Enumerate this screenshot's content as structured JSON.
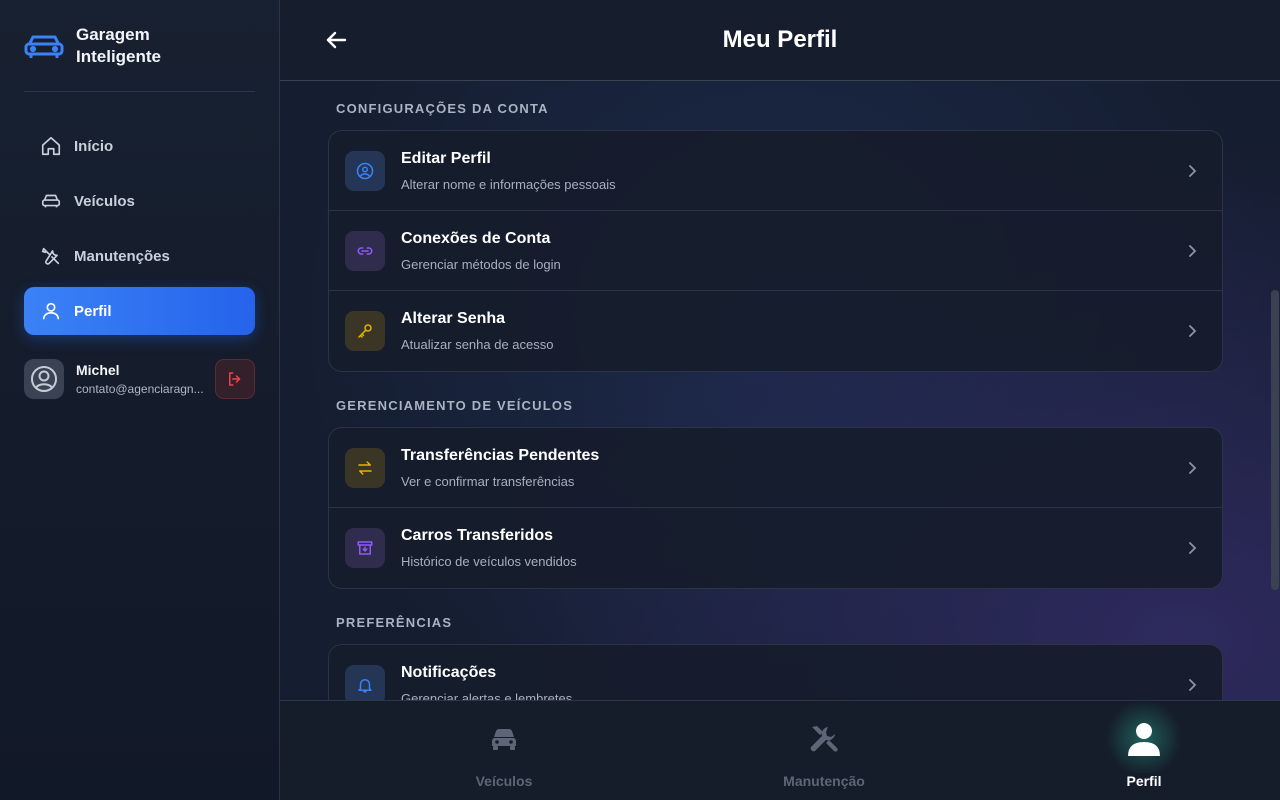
{
  "brand": {
    "name": "Garagem Inteligente",
    "icon": "car-icon",
    "color": "#3b82f6"
  },
  "sidebar": {
    "items": [
      {
        "label": "Início",
        "icon": "home-icon",
        "active": false
      },
      {
        "label": "Veículos",
        "icon": "car-icon",
        "active": false
      },
      {
        "label": "Manutenções",
        "icon": "tools-icon",
        "active": false
      },
      {
        "label": "Perfil",
        "icon": "user-icon",
        "active": true
      }
    ],
    "user": {
      "name": "Michel",
      "email": "contato@agenciaragn..."
    }
  },
  "header": {
    "title": "Meu Perfil",
    "back_icon": "arrow-left-icon"
  },
  "sections": [
    {
      "title": "CONFIGURAÇÕES DA CONTA",
      "items": [
        {
          "title": "Editar Perfil",
          "subtitle": "Alterar nome e informações pessoais",
          "icon": "user-circle-icon",
          "color": "#3b82f6"
        },
        {
          "title": "Conexões de Conta",
          "subtitle": "Gerenciar métodos de login",
          "icon": "link-icon",
          "color": "#8b5cf6"
        },
        {
          "title": "Alterar Senha",
          "subtitle": "Atualizar senha de acesso",
          "icon": "key-icon",
          "color": "#eab308"
        }
      ]
    },
    {
      "title": "GERENCIAMENTO DE VEÍCULOS",
      "items": [
        {
          "title": "Transferências Pendentes",
          "subtitle": "Ver e confirmar transferências",
          "icon": "swap-icon",
          "color": "#eab308"
        },
        {
          "title": "Carros Transferidos",
          "subtitle": "Histórico de veículos vendidos",
          "icon": "archive-icon",
          "color": "#8b5cf6"
        }
      ]
    },
    {
      "title": "PREFERÊNCIAS",
      "items": [
        {
          "title": "Notificações",
          "subtitle": "Gerenciar alertas e lembretes",
          "icon": "bell-icon",
          "color": "#3b82f6"
        }
      ]
    }
  ],
  "bottom_nav": [
    {
      "label": "Veículos",
      "icon": "car-icon",
      "active": false
    },
    {
      "label": "Manutenção",
      "icon": "tools-icon",
      "active": false
    },
    {
      "label": "Perfil",
      "icon": "user-icon",
      "active": true
    }
  ]
}
